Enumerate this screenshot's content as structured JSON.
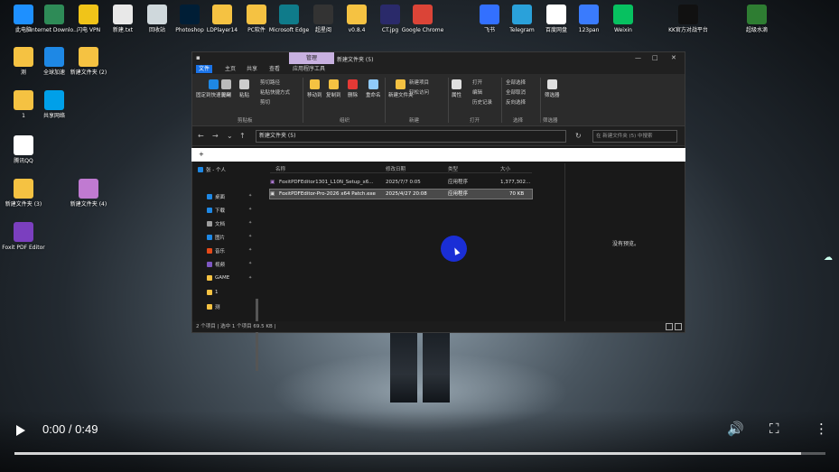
{
  "desktop_icons": [
    {
      "label": "此电脑",
      "color": "#1e90ff"
    },
    {
      "label": "Internet Downlo...",
      "color": "#2e8b57"
    },
    {
      "label": "闪电 VPN",
      "color": "#f0c419"
    },
    {
      "label": "新建.txt",
      "color": "#e8e8e8"
    },
    {
      "label": "回收站",
      "color": "#cfd8dc"
    },
    {
      "label": "Photoshop",
      "color": "#001e36"
    },
    {
      "label": "LDPlayer14",
      "color": "#f5c242"
    },
    {
      "label": "PC软件",
      "color": "#f5c242"
    },
    {
      "label": "Microsoft Edge",
      "color": "#0f7b8a"
    },
    {
      "label": "超星阅",
      "color": "#333333"
    },
    {
      "label": "v0.8.4",
      "color": "#f5c242"
    },
    {
      "label": "CT.jpg",
      "color": "#2a2a6a"
    },
    {
      "label": "Google Chrome",
      "color": "#db4437"
    },
    {
      "label": "飞书",
      "color": "#3370ff"
    },
    {
      "label": "Telegram",
      "color": "#2aa1da"
    },
    {
      "label": "百度网盘",
      "color": "#ffffff"
    },
    {
      "label": "123pan",
      "color": "#3a7bfd"
    },
    {
      "label": "Weixin",
      "color": "#07c160"
    },
    {
      "label": "KK官方对战平台",
      "color": "#111111"
    },
    {
      "label": "超级水滴",
      "color": "#2e7d32"
    },
    {
      "label": "测",
      "color": "#f5c242"
    },
    {
      "label": "全球加速",
      "color": "#1e88e5"
    },
    {
      "label": "新建文件夹 (2)",
      "color": "#f5c242"
    },
    {
      "label": "1",
      "color": "#f5c242"
    },
    {
      "label": "共享网络",
      "color": "#00a0e9"
    },
    {
      "label": "腾讯QQ",
      "color": "#ffffff"
    },
    {
      "label": "新建文件夹 (3)",
      "color": "#f5c242"
    },
    {
      "label": "新建文件夹 (4)",
      "color": "#c07ad1"
    },
    {
      "label": "Foxit PDF Editor",
      "color": "#7b3fbf"
    }
  ],
  "explorer": {
    "context_tab": "管理",
    "title": "新建文件夹 (5)",
    "menu_tabs": [
      "文件",
      "主页",
      "共享",
      "查看",
      "应用程序工具"
    ],
    "ribbon": {
      "pin": "固定到快速访问",
      "copy": "复制",
      "paste": "粘贴",
      "cut": "剪切路径",
      "copy_path": "复制路径",
      "paste_shortcut": "粘贴快捷方式",
      "cut2": "剪切",
      "move_to": "移动到",
      "copy_to": "复制到",
      "delete": "删除",
      "rename": "重命名",
      "new_folder": "新建文件夹",
      "new_item": "新建项目",
      "easy_access": "轻松访问",
      "properties": "属性",
      "open": "打开",
      "edit": "编辑",
      "history": "历史记录",
      "select_all": "全部选择",
      "select_none": "全部取消",
      "invert": "反向选择",
      "filter": "筛选器",
      "groups": [
        "剪贴板",
        "组织",
        "新建",
        "打开",
        "选择",
        "筛选器"
      ]
    },
    "address": "新建文件夹 (5)",
    "search_placeholder": "在 新建文件夹 (5) 中搜索",
    "white_bar_text": "+",
    "nav": [
      {
        "label": "张 - 个人",
        "color": "#1e88e5"
      },
      {
        "label": "桌面",
        "color": "#1e88e5"
      },
      {
        "label": "下载",
        "color": "#1e88e5"
      },
      {
        "label": "文档",
        "color": "#9e9e9e"
      },
      {
        "label": "图片",
        "color": "#1e88e5"
      },
      {
        "label": "音乐",
        "color": "#e64a19"
      },
      {
        "label": "视频",
        "color": "#7e57c2"
      },
      {
        "label": "GAME",
        "color": "#f5c242"
      },
      {
        "label": "1",
        "color": "#f5c242"
      },
      {
        "label": "测",
        "color": "#f5c242"
      }
    ],
    "columns": [
      "名称",
      "修改日期",
      "类型",
      "大小"
    ],
    "files": [
      {
        "name": "FoxitPDFEditor1301_L10N_Setup_x6...",
        "date": "2025/7/7 0:05",
        "type": "应用程序",
        "size": "1,377,302..."
      },
      {
        "name": "FoxitPDFEditor-Pro-2026 x64 Patch.exe",
        "date": "2025/4/27 20:08",
        "type": "应用程序",
        "size": "70 KB"
      }
    ],
    "preview_text": "没有预览。",
    "status": "2 个项目  |  选中 1 个项目  69.5 KB  |"
  },
  "video": {
    "time": "0:00 / 0:49",
    "progress": 0.97
  }
}
